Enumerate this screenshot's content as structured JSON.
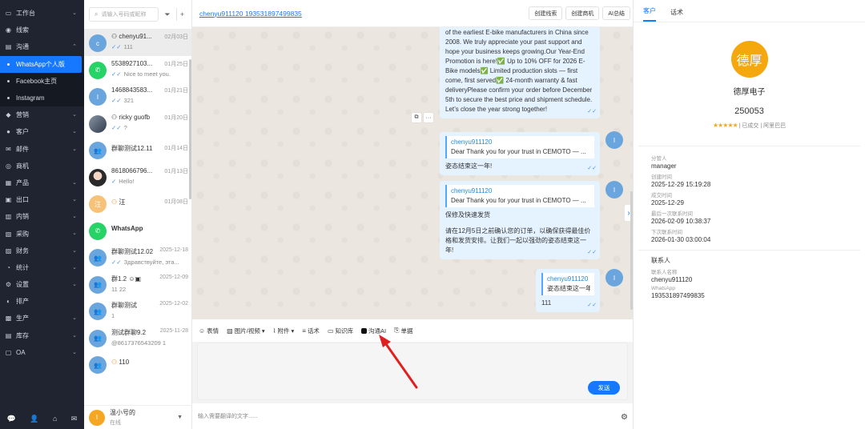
{
  "nav": {
    "items": [
      {
        "label": "工作台",
        "icon": "desk-icon"
      },
      {
        "label": "线索",
        "icon": "lead-icon"
      },
      {
        "label": "沟通",
        "icon": "chat-icon"
      },
      {
        "label": "营销",
        "icon": "marketing-icon"
      },
      {
        "label": "客户",
        "icon": "customer-icon"
      },
      {
        "label": "邮件",
        "icon": "mail-icon"
      },
      {
        "label": "商机",
        "icon": "opportunity-icon"
      },
      {
        "label": "产品",
        "icon": "product-icon"
      },
      {
        "label": "出口",
        "icon": "export-icon"
      },
      {
        "label": "内销",
        "icon": "domestic-icon"
      },
      {
        "label": "采购",
        "icon": "purchase-icon"
      },
      {
        "label": "财务",
        "icon": "finance-icon"
      },
      {
        "label": "统计",
        "icon": "stats-icon"
      },
      {
        "label": "设置",
        "icon": "settings-icon"
      },
      {
        "label": "排产",
        "icon": "schedule-icon"
      },
      {
        "label": "生产",
        "icon": "production-icon"
      },
      {
        "label": "库存",
        "icon": "inventory-icon"
      },
      {
        "label": "OA",
        "icon": "oa-icon"
      }
    ],
    "sub": [
      "WhatsApp个人版",
      "Facebook主页",
      "Instagram"
    ]
  },
  "search": {
    "placeholder": "请输入号码或昵称"
  },
  "conversations": [
    {
      "avatar": "c",
      "name": "chenyu91...",
      "time": "02月03日",
      "msg": "111"
    },
    {
      "avatar": "",
      "name": "5538927103...",
      "time": "01月25日",
      "msg": "Nice to meet you."
    },
    {
      "avatar": "I",
      "name": "1468843583...",
      "time": "01月21日",
      "msg": "321"
    },
    {
      "avatar": "",
      "name": "ricky guofb",
      "time": "01月20日",
      "msg": "?"
    },
    {
      "avatar": "",
      "name": "群聊测试12.11",
      "time": "01月14日",
      "msg": ""
    },
    {
      "avatar": "",
      "name": "8618066796...",
      "time": "01月13日",
      "msg": "Hello!"
    },
    {
      "avatar": "汪",
      "name": "汪",
      "time": "01月08日",
      "msg": ""
    },
    {
      "avatar": "",
      "name": "WhatsApp",
      "time": "",
      "msg": ""
    },
    {
      "avatar": "",
      "name": "群聊测试12.02",
      "time": "2025-12-18",
      "msg": "Здравствуйте, эта..."
    },
    {
      "avatar": "",
      "name": "群1.2",
      "time": "2025-12-09",
      "msg": "11 22"
    },
    {
      "avatar": "",
      "name": "群聊测试",
      "time": "2025-12-02",
      "msg": "1"
    },
    {
      "avatar": "",
      "name": "测试群聊9.2",
      "time": "2025-11-28",
      "msg": "@8617376543209 1"
    },
    {
      "avatar": "",
      "name": "110",
      "time": "",
      "msg": ""
    }
  ],
  "account": {
    "avatar": "I",
    "name": "温小号的",
    "status": "在线"
  },
  "chat": {
    "title": "chenyu911120 193531897499835",
    "header_buttons": [
      "创建线索",
      "创建商机",
      "AI总结"
    ],
    "msg1": "of the earliest E-bike manufacturers in China since 2008. We truly appreciate your past support and hope your business keeps growing.Our Year-End Promotion is here!✅ Up to 10% OFF for 2026 E-Bike models✅ Limited production slots — first come, first served✅ 24-month warranty & fast deliveryPlease confirm your order before December 5th to secure the best price and shipment schedule. Let’s close the year strong together!",
    "reply1": {
      "qname": "chenyu911120",
      "qtext": "Dear Thank you for your trust in CEMOTO — ...",
      "text": "姿态结束这一年!"
    },
    "reply2": {
      "qname": "chenyu911120",
      "qtext": "Dear Thank you for your trust in CEMOTO — ...",
      "text1": "保修及快速发货",
      "text2": "请在12月5日之前确认您的订单，以确保获得最佳价格和发货安排。让我们一起以强劲的姿态结束这一年!"
    },
    "reply3": {
      "qname": "chenyu911120",
      "qtext": "姿态结束这一年!",
      "text": "111"
    },
    "msg_avatar": "I",
    "toolbar": [
      "表情",
      "图片/视频",
      "附件",
      "话术",
      "知识库",
      "沟通AI",
      "单据"
    ],
    "send_label": "发送",
    "translate_placeholder": "输入需要翻译的文字......"
  },
  "customer": {
    "tabs": [
      "客户",
      "话术"
    ],
    "logo_text": "德厚",
    "company": "德厚电子",
    "code": "250053",
    "stars": "★★★★★",
    "rating_text": "| 已成交 | 阿里巴巴",
    "fields": [
      {
        "label": "分管人",
        "value": "manager"
      },
      {
        "label": "创建时间",
        "value": "2025-12-29 15:19:28"
      },
      {
        "label": "成交时间",
        "value": "2025-12-29"
      },
      {
        "label": "最后一次联系时间",
        "value": "2026-02-09 10:38:37"
      },
      {
        "label": "下次联系时间",
        "value": "2026-01-30 03:00:04"
      }
    ],
    "contact_title": "联系人",
    "contact_fields": [
      {
        "label": "联系人名称",
        "value": "chenyu911120"
      },
      {
        "label": "WhatsApp",
        "value": "193531897499835"
      }
    ]
  },
  "colors": {
    "accent": "#1677ff",
    "nav_bg": "#1f2430",
    "bubble": "#e5f2ff",
    "logo": "#f5a80e",
    "arrow": "#e02020"
  }
}
